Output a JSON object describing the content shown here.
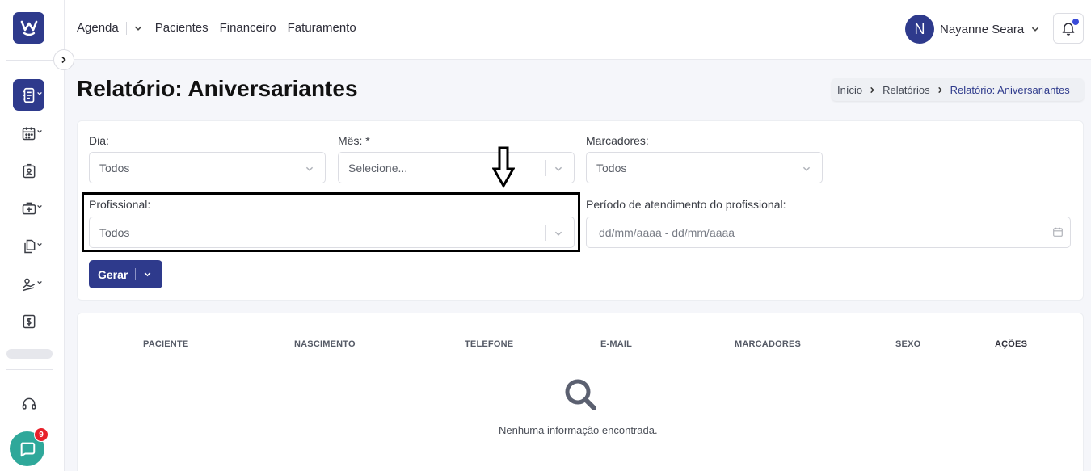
{
  "topnav": {
    "agenda": "Agenda",
    "pacientes": "Pacientes",
    "financeiro": "Financeiro",
    "faturamento": "Faturamento"
  },
  "user": {
    "initial": "N",
    "name": "Nayanne Seara"
  },
  "page": {
    "title": "Relatório: Aniversariantes"
  },
  "breadcrumb": {
    "inicio": "Início",
    "relatorios": "Relatórios",
    "current": "Relatório: Aniversariantes"
  },
  "filters": {
    "dia": {
      "label": "Dia:",
      "value": "Todos"
    },
    "mes": {
      "label": "Mês: *",
      "placeholder": "Selecione..."
    },
    "marcadores": {
      "label": "Marcadores:",
      "value": "Todos"
    },
    "profissional": {
      "label": "Profissional:",
      "value": "Todos"
    },
    "periodo": {
      "label": "Período de atendimento do profissional:",
      "placeholder": "dd/mm/aaaa - dd/mm/aaaa"
    }
  },
  "actions": {
    "gerar": "Gerar"
  },
  "table": {
    "columns": [
      "PACIENTE",
      "NASCIMENTO",
      "TELEFONE",
      "E-MAIL",
      "MARCADORES",
      "SEXO",
      "AÇÕES"
    ],
    "empty_message": "Nenhuma informação encontrada."
  },
  "chat": {
    "badge_count": "9"
  },
  "colors": {
    "primary": "#2e3a8c",
    "chat": "#2fa89a",
    "badge": "#e8202a",
    "notification_dot": "#3a4bd8"
  },
  "icons": {
    "logo": "w-smile-logo",
    "bell": "bell-icon",
    "chat": "chat-icon",
    "search": "search-icon",
    "calendar": "calendar-icon"
  }
}
